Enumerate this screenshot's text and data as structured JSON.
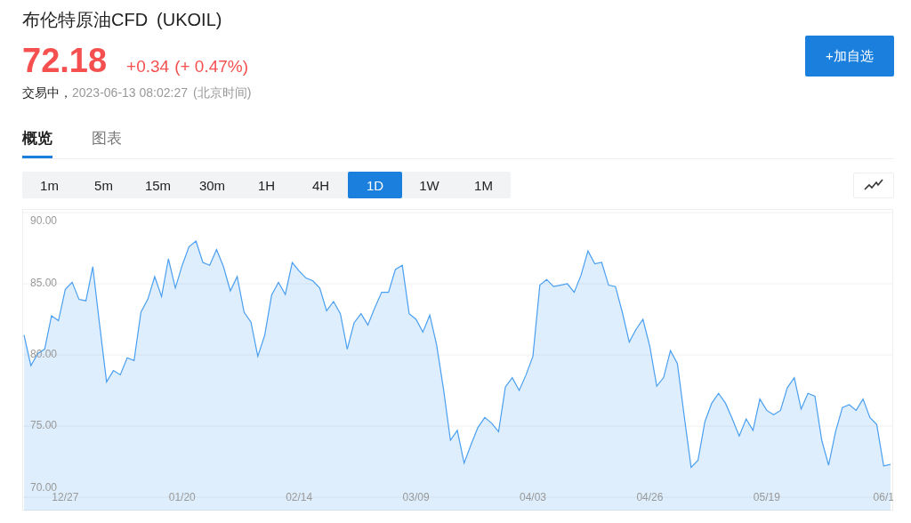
{
  "instrument": {
    "name": "布伦特原油CFD",
    "symbol": "(UKOIL)"
  },
  "quote": {
    "price": "72.18",
    "change": "+0.34",
    "change_percent": "(+ 0.47%)"
  },
  "status": {
    "state": "交易中，",
    "time": "2023-06-13 08:02:27",
    "timezone": "(北京时间)"
  },
  "watch_button": "+加自选",
  "tabs": [
    {
      "label": "概览",
      "selected": true
    },
    {
      "label": "图表",
      "selected": false
    }
  ],
  "periods": [
    {
      "label": "1m",
      "selected": false
    },
    {
      "label": "5m",
      "selected": false
    },
    {
      "label": "15m",
      "selected": false
    },
    {
      "label": "30m",
      "selected": false
    },
    {
      "label": "1H",
      "selected": false
    },
    {
      "label": "4H",
      "selected": false
    },
    {
      "label": "1D",
      "selected": true
    },
    {
      "label": "1W",
      "selected": false
    },
    {
      "label": "1M",
      "selected": false
    }
  ],
  "chart": {
    "chart_data": {
      "type": "area",
      "grid": true,
      "ylim": [
        70,
        90
      ],
      "categories": [
        null,
        null,
        null,
        null,
        null,
        null,
        "12/27",
        null,
        null,
        null,
        null,
        null,
        null,
        null,
        null,
        null,
        null,
        null,
        null,
        null,
        null,
        null,
        null,
        "01/20",
        null,
        null,
        null,
        null,
        null,
        null,
        null,
        null,
        null,
        null,
        null,
        null,
        null,
        null,
        null,
        null,
        "02/14",
        null,
        null,
        null,
        null,
        null,
        null,
        null,
        null,
        null,
        null,
        null,
        null,
        null,
        null,
        null,
        null,
        "03/09",
        null,
        null,
        null,
        null,
        null,
        null,
        null,
        null,
        null,
        null,
        null,
        null,
        null,
        null,
        null,
        null,
        "04/03",
        null,
        null,
        null,
        null,
        null,
        null,
        null,
        null,
        null,
        null,
        null,
        null,
        null,
        null,
        null,
        null,
        "04/26",
        null,
        null,
        null,
        null,
        null,
        null,
        null,
        null,
        null,
        null,
        null,
        null,
        null,
        null,
        null,
        null,
        "05/19",
        null,
        null,
        null,
        null,
        null,
        null,
        null,
        null,
        null,
        null,
        null,
        null,
        null,
        null,
        null,
        null,
        "06/1",
        null
      ],
      "yticks": [
        {
          "value": 90,
          "label": "90.00"
        },
        {
          "value": 85,
          "label": "85.00"
        },
        {
          "value": 80,
          "label": "80.00"
        },
        {
          "value": 75,
          "label": "75.00"
        },
        {
          "value": 70,
          "label": "70.00"
        }
      ],
      "series": [
        {
          "color": "#4a9ff0",
          "values": [
            81.4,
            79.25,
            80.1,
            80.4,
            82.75,
            82.4,
            84.6,
            85.1,
            83.9,
            83.8,
            86.2,
            82.1,
            78.1,
            78.9,
            78.6,
            79.8,
            79.6,
            83.0,
            83.9,
            85.5,
            84.1,
            86.75,
            84.7,
            86.3,
            87.6,
            88.0,
            86.5,
            86.3,
            87.4,
            86.2,
            84.5,
            85.5,
            83.0,
            82.3,
            79.9,
            81.4,
            84.2,
            85.1,
            84.25,
            86.5,
            85.9,
            85.4,
            85.2,
            84.7,
            83.1,
            83.75,
            82.9,
            80.4,
            82.25,
            82.9,
            82.1,
            83.3,
            84.4,
            84.4,
            86.0,
            86.3,
            82.9,
            82.5,
            81.6,
            82.8,
            80.7,
            77.6,
            74.0,
            74.7,
            72.4,
            73.7,
            74.9,
            75.6,
            75.2,
            74.6,
            77.75,
            78.4,
            77.5,
            78.6,
            79.9,
            84.9,
            85.3,
            84.8,
            84.9,
            85.0,
            84.4,
            85.6,
            87.3,
            86.4,
            86.5,
            84.9,
            84.8,
            83.0,
            80.9,
            81.8,
            82.5,
            80.6,
            77.8,
            78.4,
            80.3,
            79.4,
            75.7,
            72.1,
            72.6,
            75.3,
            76.6,
            77.3,
            76.6,
            75.5,
            74.3,
            75.5,
            74.7,
            76.9,
            76.1,
            75.8,
            76.1,
            77.7,
            78.4,
            76.2,
            77.3,
            77.1,
            74.0,
            72.25,
            74.6,
            76.3,
            76.5,
            76.1,
            76.9,
            75.6,
            75.1,
            72.2,
            72.3
          ]
        }
      ]
    }
  }
}
